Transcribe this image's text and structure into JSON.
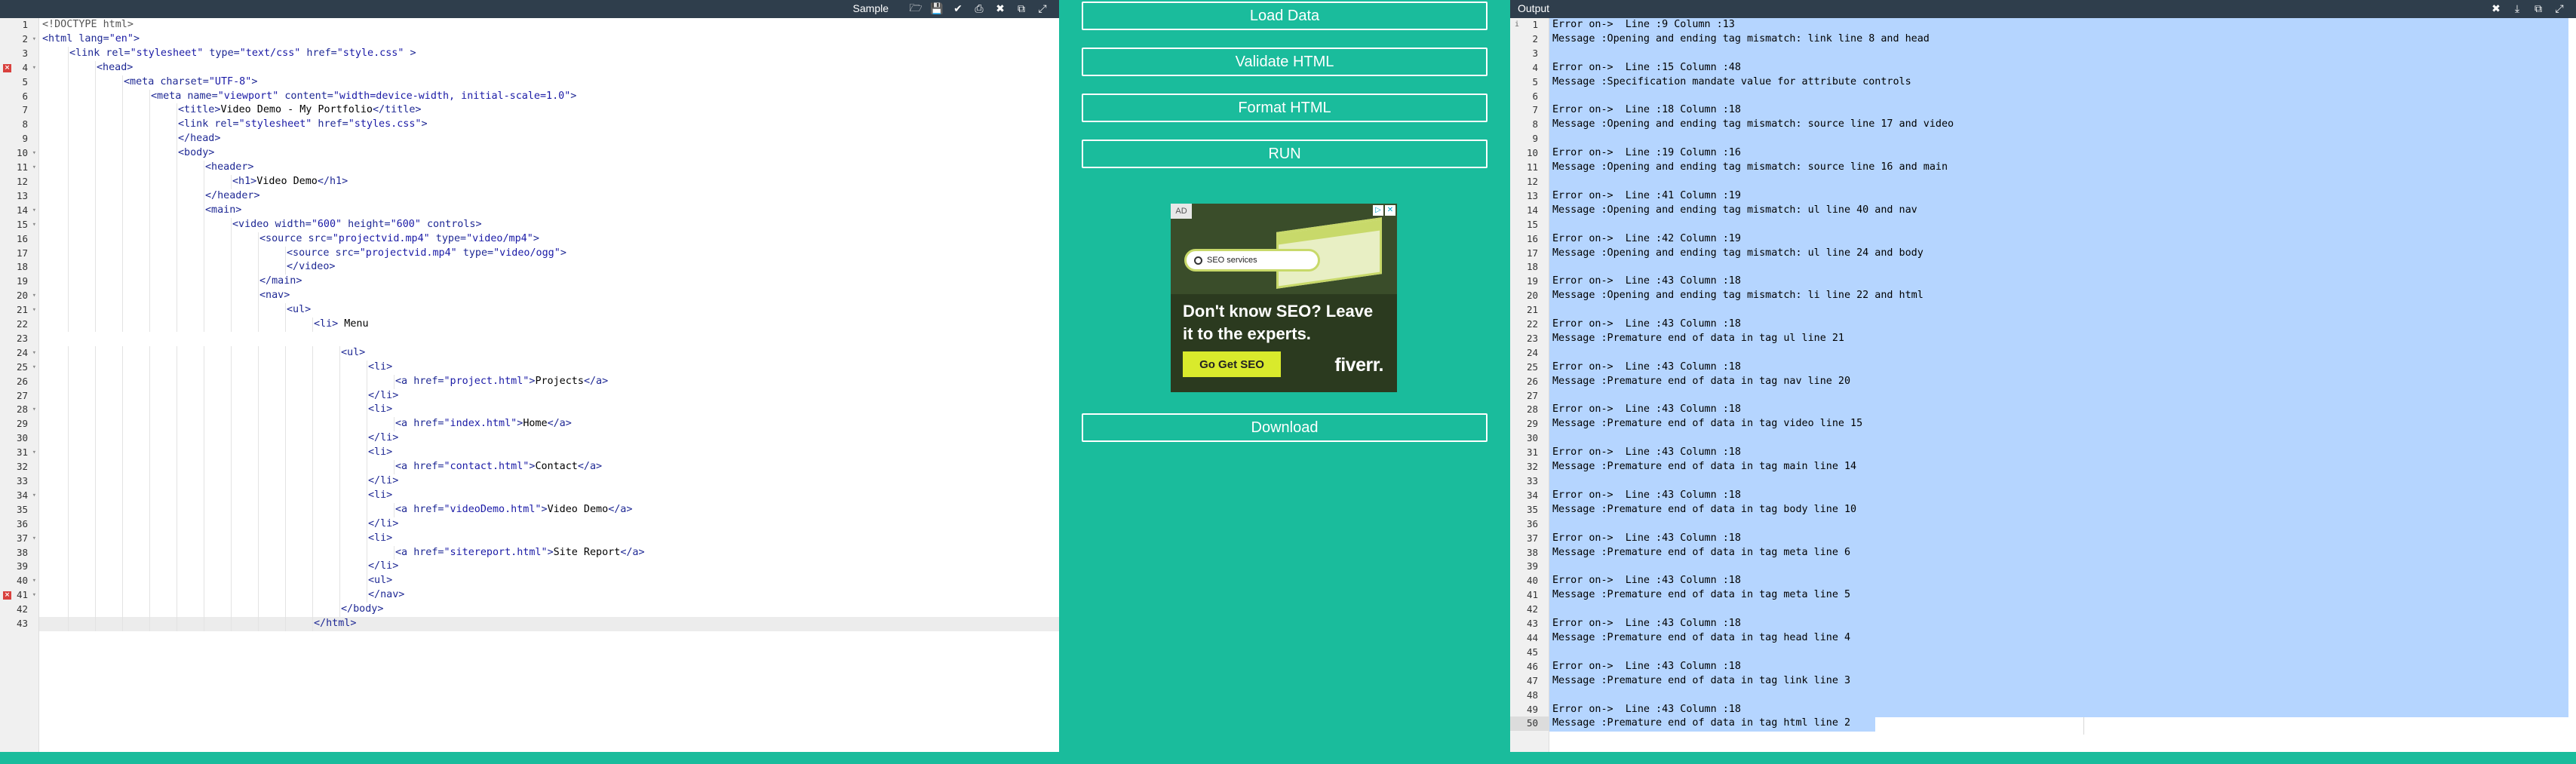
{
  "left_panel": {
    "title": "Sample",
    "icons": [
      "open-folder-icon",
      "save-icon",
      "check-icon",
      "print-icon",
      "close-icon",
      "copy-icon",
      "expand-icon"
    ],
    "error_lines": [
      4,
      41
    ],
    "active_line": 43,
    "folded_lines": [
      2,
      4,
      10,
      11,
      14,
      15,
      20,
      21,
      24,
      25,
      28,
      31,
      34,
      37,
      40,
      41
    ],
    "lines": [
      {
        "n": "1",
        "indent": 0,
        "segs": [
          [
            "doc",
            "<!DOCTYPE html>"
          ]
        ]
      },
      {
        "n": "2",
        "indent": 0,
        "segs": [
          [
            "tag",
            "<html "
          ],
          [
            "attr",
            "lang="
          ],
          [
            "str",
            "\"en\""
          ],
          [
            "tag",
            ">"
          ]
        ]
      },
      {
        "n": "3",
        "indent": 1,
        "segs": [
          [
            "tag",
            "<link "
          ],
          [
            "attr",
            "rel="
          ],
          [
            "str",
            "\"stylesheet\""
          ],
          [
            "attr",
            " type="
          ],
          [
            "str",
            "\"text/css\""
          ],
          [
            "attr",
            " href="
          ],
          [
            "str",
            "\"style.css\""
          ],
          [
            "tag",
            " >"
          ]
        ]
      },
      {
        "n": "4",
        "indent": 2,
        "segs": [
          [
            "tag",
            "<head>"
          ]
        ]
      },
      {
        "n": "5",
        "indent": 3,
        "segs": [
          [
            "tag",
            "<meta "
          ],
          [
            "attr",
            "charset="
          ],
          [
            "str",
            "\"UTF-8\""
          ],
          [
            "tag",
            ">"
          ]
        ]
      },
      {
        "n": "6",
        "indent": 4,
        "segs": [
          [
            "tag",
            "<meta "
          ],
          [
            "attr",
            "name="
          ],
          [
            "str",
            "\"viewport\""
          ],
          [
            "attr",
            " content="
          ],
          [
            "str",
            "\"width=device-width, initial-scale=1.0\""
          ],
          [
            "tag",
            ">"
          ]
        ]
      },
      {
        "n": "7",
        "indent": 5,
        "segs": [
          [
            "tag",
            "<title>"
          ],
          [
            "txt",
            "Video Demo - My Portfolio"
          ],
          [
            "tag",
            "</title>"
          ]
        ]
      },
      {
        "n": "8",
        "indent": 5,
        "segs": [
          [
            "tag",
            "<link "
          ],
          [
            "attr",
            "rel="
          ],
          [
            "str",
            "\"stylesheet\""
          ],
          [
            "attr",
            " href="
          ],
          [
            "str",
            "\"styles.css\""
          ],
          [
            "tag",
            ">"
          ]
        ]
      },
      {
        "n": "9",
        "indent": 5,
        "segs": [
          [
            "tag",
            "</head>"
          ]
        ]
      },
      {
        "n": "10",
        "indent": 5,
        "segs": [
          [
            "tag",
            "<body>"
          ]
        ]
      },
      {
        "n": "11",
        "indent": 6,
        "segs": [
          [
            "tag",
            "<header>"
          ]
        ]
      },
      {
        "n": "12",
        "indent": 7,
        "segs": [
          [
            "tag",
            "<h1>"
          ],
          [
            "txt",
            "Video Demo"
          ],
          [
            "tag",
            "</h1>"
          ]
        ]
      },
      {
        "n": "13",
        "indent": 6,
        "segs": [
          [
            "tag",
            "</header>"
          ]
        ]
      },
      {
        "n": "14",
        "indent": 6,
        "segs": [
          [
            "tag",
            "<main>"
          ]
        ]
      },
      {
        "n": "15",
        "indent": 7,
        "segs": [
          [
            "tag",
            "<video "
          ],
          [
            "attr",
            "width="
          ],
          [
            "str",
            "\"600\""
          ],
          [
            "attr",
            " height="
          ],
          [
            "str",
            "\"600\""
          ],
          [
            "attr",
            " controls"
          ],
          [
            "tag",
            ">"
          ]
        ]
      },
      {
        "n": "16",
        "indent": 8,
        "segs": [
          [
            "tag",
            "<source "
          ],
          [
            "attr",
            "src="
          ],
          [
            "str",
            "\"projectvid.mp4\""
          ],
          [
            "attr",
            " type="
          ],
          [
            "str",
            "\"video/mp4\""
          ],
          [
            "tag",
            ">"
          ]
        ]
      },
      {
        "n": "17",
        "indent": 9,
        "segs": [
          [
            "tag",
            "<source "
          ],
          [
            "attr",
            "src="
          ],
          [
            "str",
            "\"projectvid.mp4\""
          ],
          [
            "attr",
            " type="
          ],
          [
            "str",
            "\"video/ogg\""
          ],
          [
            "tag",
            ">"
          ]
        ]
      },
      {
        "n": "18",
        "indent": 9,
        "segs": [
          [
            "tag",
            "</video>"
          ]
        ]
      },
      {
        "n": "19",
        "indent": 8,
        "segs": [
          [
            "tag",
            "</main>"
          ]
        ]
      },
      {
        "n": "20",
        "indent": 8,
        "segs": [
          [
            "tag",
            "<nav>"
          ]
        ]
      },
      {
        "n": "21",
        "indent": 9,
        "segs": [
          [
            "tag",
            "<ul>"
          ]
        ]
      },
      {
        "n": "22",
        "indent": 10,
        "segs": [
          [
            "tag",
            "<li>"
          ],
          [
            "txt",
            " Menu"
          ]
        ]
      },
      {
        "n": "23",
        "indent": 0,
        "segs": []
      },
      {
        "n": "24",
        "indent": 11,
        "segs": [
          [
            "tag",
            "<ul>"
          ]
        ]
      },
      {
        "n": "25",
        "indent": 12,
        "segs": [
          [
            "tag",
            "<li>"
          ]
        ]
      },
      {
        "n": "26",
        "indent": 13,
        "segs": [
          [
            "tag",
            "<a "
          ],
          [
            "attr",
            "href="
          ],
          [
            "str",
            "\"project.html\""
          ],
          [
            "tag",
            ">"
          ],
          [
            "txt",
            "Projects"
          ],
          [
            "tag",
            "</a>"
          ]
        ]
      },
      {
        "n": "27",
        "indent": 12,
        "segs": [
          [
            "tag",
            "</li>"
          ]
        ]
      },
      {
        "n": "28",
        "indent": 12,
        "segs": [
          [
            "tag",
            "<li>"
          ]
        ]
      },
      {
        "n": "29",
        "indent": 13,
        "segs": [
          [
            "tag",
            "<a "
          ],
          [
            "attr",
            "href="
          ],
          [
            "str",
            "\"index.html\""
          ],
          [
            "tag",
            ">"
          ],
          [
            "txt",
            "Home"
          ],
          [
            "tag",
            "</a>"
          ]
        ]
      },
      {
        "n": "30",
        "indent": 12,
        "segs": [
          [
            "tag",
            "</li>"
          ]
        ]
      },
      {
        "n": "31",
        "indent": 12,
        "segs": [
          [
            "tag",
            "<li>"
          ]
        ]
      },
      {
        "n": "32",
        "indent": 13,
        "segs": [
          [
            "tag",
            "<a "
          ],
          [
            "attr",
            "href="
          ],
          [
            "str",
            "\"contact.html\""
          ],
          [
            "tag",
            ">"
          ],
          [
            "txt",
            "Contact"
          ],
          [
            "tag",
            "</a>"
          ]
        ]
      },
      {
        "n": "33",
        "indent": 12,
        "segs": [
          [
            "tag",
            "</li>"
          ]
        ]
      },
      {
        "n": "34",
        "indent": 12,
        "segs": [
          [
            "tag",
            "<li>"
          ]
        ]
      },
      {
        "n": "35",
        "indent": 13,
        "segs": [
          [
            "tag",
            "<a "
          ],
          [
            "attr",
            "href="
          ],
          [
            "str",
            "\"videoDemo.html\""
          ],
          [
            "tag",
            ">"
          ],
          [
            "txt",
            "Video Demo"
          ],
          [
            "tag",
            "</a>"
          ]
        ]
      },
      {
        "n": "36",
        "indent": 12,
        "segs": [
          [
            "tag",
            "</li>"
          ]
        ]
      },
      {
        "n": "37",
        "indent": 12,
        "segs": [
          [
            "tag",
            "<li>"
          ]
        ]
      },
      {
        "n": "38",
        "indent": 13,
        "segs": [
          [
            "tag",
            "<a "
          ],
          [
            "attr",
            "href="
          ],
          [
            "str",
            "\"sitereport.html\""
          ],
          [
            "tag",
            ">"
          ],
          [
            "txt",
            "Site Report"
          ],
          [
            "tag",
            "</a>"
          ]
        ]
      },
      {
        "n": "39",
        "indent": 12,
        "segs": [
          [
            "tag",
            "</li>"
          ]
        ]
      },
      {
        "n": "40",
        "indent": 12,
        "segs": [
          [
            "tag",
            "<ul>"
          ]
        ]
      },
      {
        "n": "41",
        "indent": 12,
        "segs": [
          [
            "tag",
            "</nav>"
          ]
        ]
      },
      {
        "n": "42",
        "indent": 11,
        "segs": [
          [
            "tag",
            "</body>"
          ]
        ]
      },
      {
        "n": "43",
        "indent": 10,
        "segs": [
          [
            "tag",
            "</html>"
          ]
        ]
      }
    ]
  },
  "center": {
    "load_label": "Load Data",
    "validate_label": "Validate HTML",
    "format_label": "Format HTML",
    "run_label": "RUN",
    "download_label": "Download",
    "ad": {
      "badge": "AD",
      "search_text": "SEO services",
      "headline": "Don't know SEO? Leave it to the experts.",
      "cta": "Go Get SEO",
      "brand": "fiverr."
    }
  },
  "right_panel": {
    "title": "Output",
    "icons": [
      "close-icon",
      "download-icon",
      "copy-icon",
      "expand-icon"
    ],
    "active_line": 50,
    "lines": [
      "Error on->  Line :9 Column :13",
      "Message :Opening and ending tag mismatch: link line 8 and head",
      "",
      "Error on->  Line :15 Column :48",
      "Message :Specification mandate value for attribute controls",
      "",
      "Error on->  Line :18 Column :18",
      "Message :Opening and ending tag mismatch: source line 17 and video",
      "",
      "Error on->  Line :19 Column :16",
      "Message :Opening and ending tag mismatch: source line 16 and main",
      "",
      "Error on->  Line :41 Column :19",
      "Message :Opening and ending tag mismatch: ul line 40 and nav",
      "",
      "Error on->  Line :42 Column :19",
      "Message :Opening and ending tag mismatch: ul line 24 and body",
      "",
      "Error on->  Line :43 Column :18",
      "Message :Opening and ending tag mismatch: li line 22 and html",
      "",
      "Error on->  Line :43 Column :18",
      "Message :Premature end of data in tag ul line 21",
      "",
      "Error on->  Line :43 Column :18",
      "Message :Premature end of data in tag nav line 20",
      "",
      "Error on->  Line :43 Column :18",
      "Message :Premature end of data in tag video line 15",
      "",
      "Error on->  Line :43 Column :18",
      "Message :Premature end of data in tag main line 14",
      "",
      "Error on->  Line :43 Column :18",
      "Message :Premature end of data in tag body line 10",
      "",
      "Error on->  Line :43 Column :18",
      "Message :Premature end of data in tag meta line 6",
      "",
      "Error on->  Line :43 Column :18",
      "Message :Premature end of data in tag meta line 5",
      "",
      "Error on->  Line :43 Column :18",
      "Message :Premature end of data in tag head line 4",
      "",
      "Error on->  Line :43 Column :18",
      "Message :Premature end of data in tag link line 3",
      "",
      "Error on->  Line :43 Column :18",
      "Message :Premature end of data in tag html line 2"
    ]
  },
  "colors": {
    "background": "#1abc9c",
    "header": "#2f3e4c",
    "selection": "#b5d5ff",
    "error": "#d9413e"
  }
}
